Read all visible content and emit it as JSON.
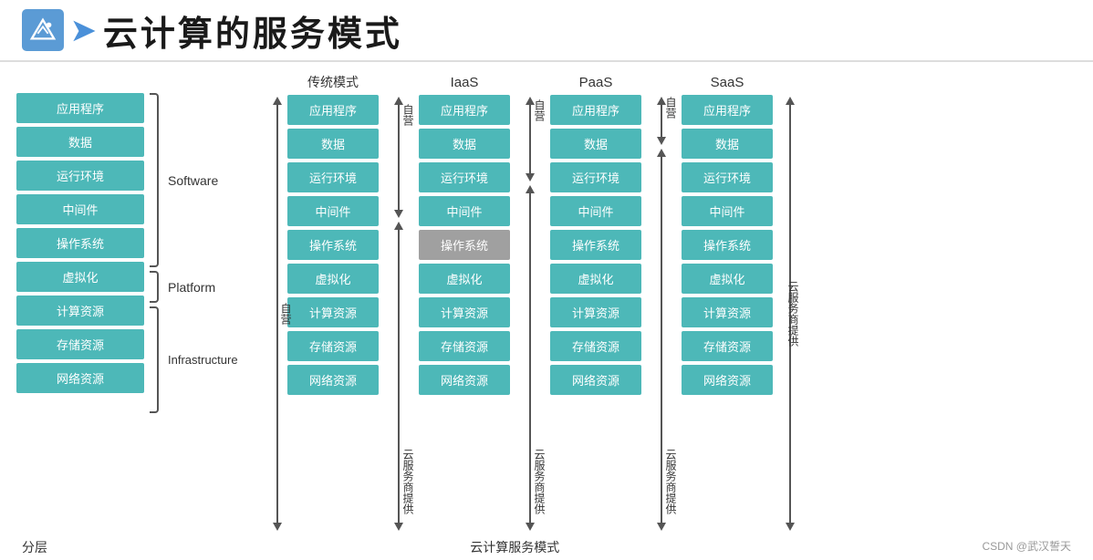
{
  "header": {
    "title": "云计算的服务模式",
    "logo_alt": "mountain-logo"
  },
  "left_section": {
    "title": "分层",
    "layers": [
      "应用程序",
      "数据",
      "运行环境",
      "中间件",
      "操作系统",
      "虚拟化",
      "计算资源",
      "存储资源",
      "网络资源"
    ],
    "brackets": [
      {
        "label": "Software",
        "rows": 5
      },
      {
        "label": "Platform",
        "rows": 1
      },
      {
        "label": "Infrastructure",
        "rows": 3
      }
    ]
  },
  "models": {
    "title": "云计算服务模式",
    "columns": [
      {
        "name": "传统模式",
        "items": [
          "应用程序",
          "数据",
          "运行环境",
          "中间件",
          "操作系统",
          "虚拟化",
          "计算资源",
          "存储资源",
          "网络资源"
        ],
        "types": [
          "teal",
          "teal",
          "teal",
          "teal",
          "teal",
          "teal",
          "teal",
          "teal",
          "teal"
        ],
        "left_label": "自营",
        "right_label": "云服务商提供"
      },
      {
        "name": "IaaS",
        "items": [
          "应用程序",
          "数据",
          "运行环境",
          "中间件",
          "操作系统",
          "虚拟化",
          "计算资源",
          "存储资源",
          "网络资源"
        ],
        "types": [
          "teal",
          "teal",
          "teal",
          "teal",
          "gray",
          "teal",
          "teal",
          "teal",
          "teal"
        ],
        "left_label": "自营",
        "right_label": "云服务商提供"
      },
      {
        "name": "PaaS",
        "items": [
          "应用程序",
          "数据",
          "运行环境",
          "中间件",
          "操作系统",
          "虚拟化",
          "计算资源",
          "存储资源",
          "网络资源"
        ],
        "types": [
          "teal",
          "teal",
          "teal",
          "teal",
          "teal",
          "teal",
          "teal",
          "teal",
          "teal"
        ],
        "left_label": "自营",
        "right_label": "云服务商提供"
      },
      {
        "name": "SaaS",
        "items": [
          "应用程序",
          "数据",
          "运行环境",
          "中间件",
          "操作系统",
          "虚拟化",
          "计算资源",
          "存储资源",
          "网络资源"
        ],
        "types": [
          "teal",
          "teal",
          "teal",
          "teal",
          "teal",
          "teal",
          "teal",
          "teal",
          "teal"
        ],
        "left_label": "",
        "right_label": "云服务商提供"
      }
    ]
  },
  "footer": {
    "left": "分层",
    "center": "云计算服务模式",
    "right": "CSDN @武汉誓天"
  }
}
